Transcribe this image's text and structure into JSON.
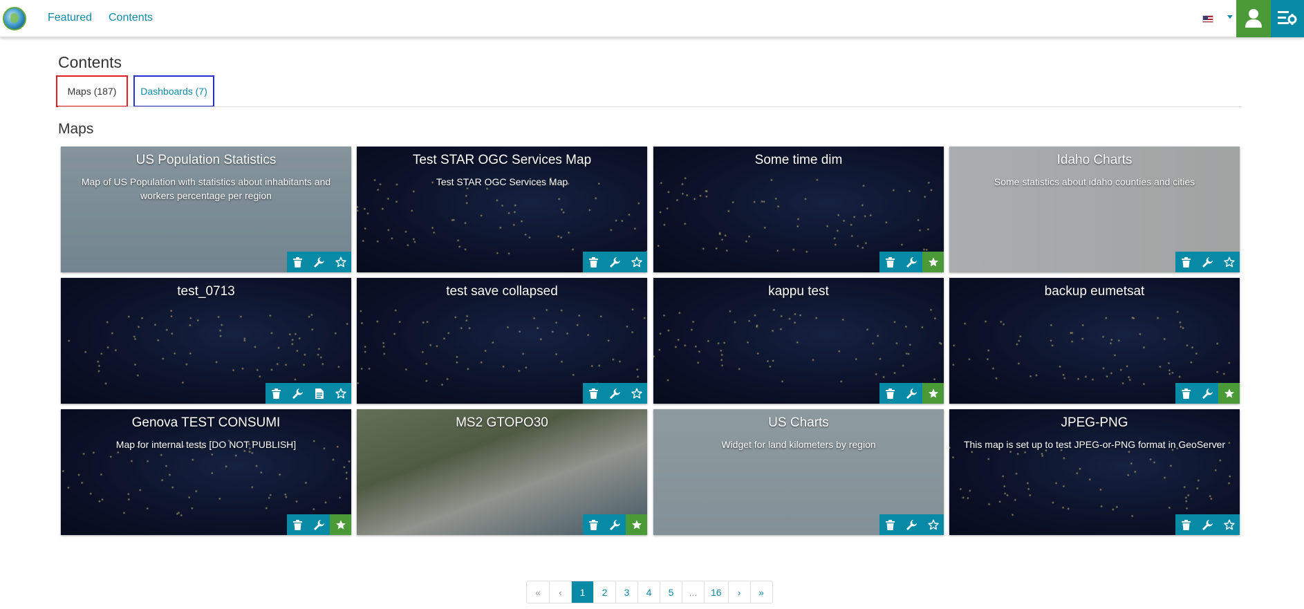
{
  "nav": {
    "featured": "Featured",
    "contents": "Contents"
  },
  "page_title": "Contents",
  "tabs": [
    {
      "label": "Maps (187)",
      "active": true
    },
    {
      "label": "Dashboards (7)",
      "active": false
    }
  ],
  "section_title": "Maps",
  "colors": {
    "accent": "#078aa5",
    "success": "#4a9a38",
    "highlight_maps": "#e51c23",
    "highlight_dashboards": "#2b2fd1"
  },
  "cards": [
    {
      "title": "US Population Statistics",
      "description": "Map of US Population with statistics about inhabitants and workers percentage per region",
      "thumb": "usmap",
      "actions": [
        "trash-icon",
        "wrench-icon",
        "star-icon"
      ],
      "favorite": false
    },
    {
      "title": "Test STAR OGC Services Map",
      "description": "Test STAR OGC Services Map",
      "thumb": "night",
      "actions": [
        "trash-icon",
        "wrench-icon",
        "star-icon"
      ],
      "favorite": false
    },
    {
      "title": "Some time dim",
      "description": "",
      "thumb": "night",
      "actions": [
        "trash-icon",
        "wrench-icon",
        "star-icon"
      ],
      "favorite": true
    },
    {
      "title": "Idaho Charts",
      "description": "Some statistics about idaho counties and cities",
      "thumb": "idaho",
      "actions": [
        "trash-icon",
        "wrench-icon",
        "star-icon"
      ],
      "favorite": false
    },
    {
      "title": "test_0713",
      "description": "",
      "thumb": "night",
      "actions": [
        "trash-icon",
        "wrench-icon",
        "details-icon",
        "star-icon"
      ],
      "favorite": false
    },
    {
      "title": "test save collapsed",
      "description": "",
      "thumb": "night",
      "actions": [
        "trash-icon",
        "wrench-icon",
        "star-icon"
      ],
      "favorite": false
    },
    {
      "title": "kappu test",
      "description": "",
      "thumb": "night",
      "actions": [
        "trash-icon",
        "wrench-icon",
        "star-icon"
      ],
      "favorite": true
    },
    {
      "title": "backup eumetsat",
      "description": "",
      "thumb": "night",
      "actions": [
        "trash-icon",
        "wrench-icon",
        "star-icon"
      ],
      "favorite": true
    },
    {
      "title": "Genova TEST CONSUMI",
      "description": "Map for internal tests [DO NOT PUBLISH]",
      "thumb": "night",
      "actions": [
        "trash-icon",
        "wrench-icon",
        "star-icon"
      ],
      "favorite": true
    },
    {
      "title": "MS2 GTOPO30",
      "description": "",
      "thumb": "gtopo",
      "actions": [
        "trash-icon",
        "wrench-icon",
        "star-icon"
      ],
      "favorite": true
    },
    {
      "title": "US Charts",
      "description": "Widget for land kilometers by region",
      "thumb": "uscharts",
      "actions": [
        "trash-icon",
        "wrench-icon",
        "star-icon"
      ],
      "favorite": false
    },
    {
      "title": "JPEG-PNG",
      "description": "This map is set up to test JPEG-or-PNG format in GeoServer",
      "thumb": "night",
      "actions": [
        "trash-icon",
        "wrench-icon",
        "star-icon"
      ],
      "favorite": false
    }
  ],
  "pagination": {
    "first": "«",
    "prev": "‹",
    "pages": [
      "1",
      "2",
      "3",
      "4",
      "5",
      "...",
      "16"
    ],
    "current": "1",
    "next": "›",
    "last": "»"
  }
}
